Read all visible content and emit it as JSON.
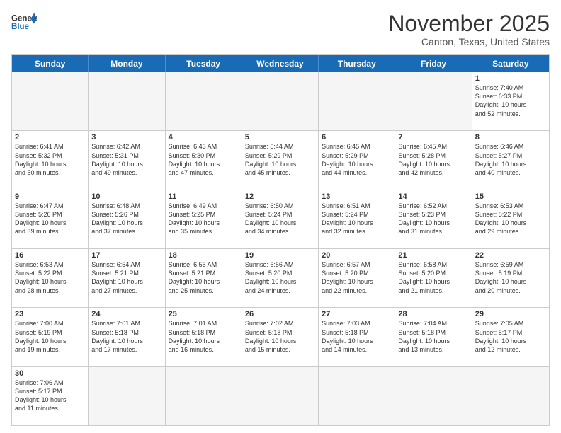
{
  "header": {
    "logo_general": "General",
    "logo_blue": "Blue",
    "month_title": "November 2025",
    "location": "Canton, Texas, United States"
  },
  "weekdays": [
    "Sunday",
    "Monday",
    "Tuesday",
    "Wednesday",
    "Thursday",
    "Friday",
    "Saturday"
  ],
  "rows": [
    [
      {
        "day": "",
        "text": ""
      },
      {
        "day": "",
        "text": ""
      },
      {
        "day": "",
        "text": ""
      },
      {
        "day": "",
        "text": ""
      },
      {
        "day": "",
        "text": ""
      },
      {
        "day": "",
        "text": ""
      },
      {
        "day": "1",
        "text": "Sunrise: 7:40 AM\nSunset: 6:33 PM\nDaylight: 10 hours\nand 52 minutes."
      }
    ],
    [
      {
        "day": "2",
        "text": "Sunrise: 6:41 AM\nSunset: 5:32 PM\nDaylight: 10 hours\nand 50 minutes."
      },
      {
        "day": "3",
        "text": "Sunrise: 6:42 AM\nSunset: 5:31 PM\nDaylight: 10 hours\nand 49 minutes."
      },
      {
        "day": "4",
        "text": "Sunrise: 6:43 AM\nSunset: 5:30 PM\nDaylight: 10 hours\nand 47 minutes."
      },
      {
        "day": "5",
        "text": "Sunrise: 6:44 AM\nSunset: 5:29 PM\nDaylight: 10 hours\nand 45 minutes."
      },
      {
        "day": "6",
        "text": "Sunrise: 6:45 AM\nSunset: 5:29 PM\nDaylight: 10 hours\nand 44 minutes."
      },
      {
        "day": "7",
        "text": "Sunrise: 6:45 AM\nSunset: 5:28 PM\nDaylight: 10 hours\nand 42 minutes."
      },
      {
        "day": "8",
        "text": "Sunrise: 6:46 AM\nSunset: 5:27 PM\nDaylight: 10 hours\nand 40 minutes."
      }
    ],
    [
      {
        "day": "9",
        "text": "Sunrise: 6:47 AM\nSunset: 5:26 PM\nDaylight: 10 hours\nand 39 minutes."
      },
      {
        "day": "10",
        "text": "Sunrise: 6:48 AM\nSunset: 5:26 PM\nDaylight: 10 hours\nand 37 minutes."
      },
      {
        "day": "11",
        "text": "Sunrise: 6:49 AM\nSunset: 5:25 PM\nDaylight: 10 hours\nand 35 minutes."
      },
      {
        "day": "12",
        "text": "Sunrise: 6:50 AM\nSunset: 5:24 PM\nDaylight: 10 hours\nand 34 minutes."
      },
      {
        "day": "13",
        "text": "Sunrise: 6:51 AM\nSunset: 5:24 PM\nDaylight: 10 hours\nand 32 minutes."
      },
      {
        "day": "14",
        "text": "Sunrise: 6:52 AM\nSunset: 5:23 PM\nDaylight: 10 hours\nand 31 minutes."
      },
      {
        "day": "15",
        "text": "Sunrise: 6:53 AM\nSunset: 5:22 PM\nDaylight: 10 hours\nand 29 minutes."
      }
    ],
    [
      {
        "day": "16",
        "text": "Sunrise: 6:53 AM\nSunset: 5:22 PM\nDaylight: 10 hours\nand 28 minutes."
      },
      {
        "day": "17",
        "text": "Sunrise: 6:54 AM\nSunset: 5:21 PM\nDaylight: 10 hours\nand 27 minutes."
      },
      {
        "day": "18",
        "text": "Sunrise: 6:55 AM\nSunset: 5:21 PM\nDaylight: 10 hours\nand 25 minutes."
      },
      {
        "day": "19",
        "text": "Sunrise: 6:56 AM\nSunset: 5:20 PM\nDaylight: 10 hours\nand 24 minutes."
      },
      {
        "day": "20",
        "text": "Sunrise: 6:57 AM\nSunset: 5:20 PM\nDaylight: 10 hours\nand 22 minutes."
      },
      {
        "day": "21",
        "text": "Sunrise: 6:58 AM\nSunset: 5:20 PM\nDaylight: 10 hours\nand 21 minutes."
      },
      {
        "day": "22",
        "text": "Sunrise: 6:59 AM\nSunset: 5:19 PM\nDaylight: 10 hours\nand 20 minutes."
      }
    ],
    [
      {
        "day": "23",
        "text": "Sunrise: 7:00 AM\nSunset: 5:19 PM\nDaylight: 10 hours\nand 19 minutes."
      },
      {
        "day": "24",
        "text": "Sunrise: 7:01 AM\nSunset: 5:18 PM\nDaylight: 10 hours\nand 17 minutes."
      },
      {
        "day": "25",
        "text": "Sunrise: 7:01 AM\nSunset: 5:18 PM\nDaylight: 10 hours\nand 16 minutes."
      },
      {
        "day": "26",
        "text": "Sunrise: 7:02 AM\nSunset: 5:18 PM\nDaylight: 10 hours\nand 15 minutes."
      },
      {
        "day": "27",
        "text": "Sunrise: 7:03 AM\nSunset: 5:18 PM\nDaylight: 10 hours\nand 14 minutes."
      },
      {
        "day": "28",
        "text": "Sunrise: 7:04 AM\nSunset: 5:18 PM\nDaylight: 10 hours\nand 13 minutes."
      },
      {
        "day": "29",
        "text": "Sunrise: 7:05 AM\nSunset: 5:17 PM\nDaylight: 10 hours\nand 12 minutes."
      }
    ],
    [
      {
        "day": "30",
        "text": "Sunrise: 7:06 AM\nSunset: 5:17 PM\nDaylight: 10 hours\nand 11 minutes."
      },
      {
        "day": "",
        "text": ""
      },
      {
        "day": "",
        "text": ""
      },
      {
        "day": "",
        "text": ""
      },
      {
        "day": "",
        "text": ""
      },
      {
        "day": "",
        "text": ""
      },
      {
        "day": "",
        "text": ""
      }
    ]
  ]
}
